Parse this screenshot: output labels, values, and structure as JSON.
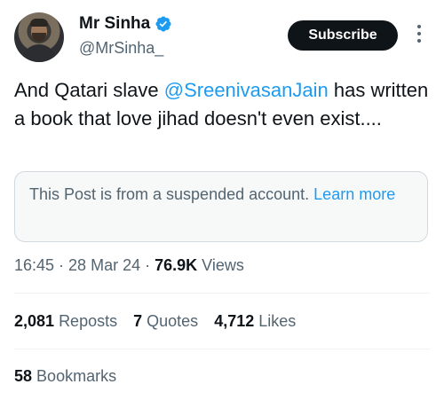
{
  "author": {
    "display_name": "Mr Sinha",
    "handle": "@MrSinha_"
  },
  "actions": {
    "subscribe_label": "Subscribe"
  },
  "tweet": {
    "text_before": "And Qatari slave ",
    "mention": "@SreenivasanJain",
    "text_after": " has written a book that love jihad doesn't even exist...."
  },
  "notice": {
    "text": "This Post is from a suspended account. ",
    "link": "Learn more"
  },
  "meta": {
    "time": "16:45",
    "date": "28 Mar 24",
    "views_count": "76.9K",
    "views_label": "Views"
  },
  "stats": {
    "reposts_count": "2,081",
    "reposts_label": "Reposts",
    "quotes_count": "7",
    "quotes_label": "Quotes",
    "likes_count": "4,712",
    "likes_label": "Likes",
    "bookmarks_count": "58",
    "bookmarks_label": "Bookmarks"
  },
  "colors": {
    "accent": "#1d9bf0",
    "text": "#0f1419",
    "muted": "#536471"
  }
}
